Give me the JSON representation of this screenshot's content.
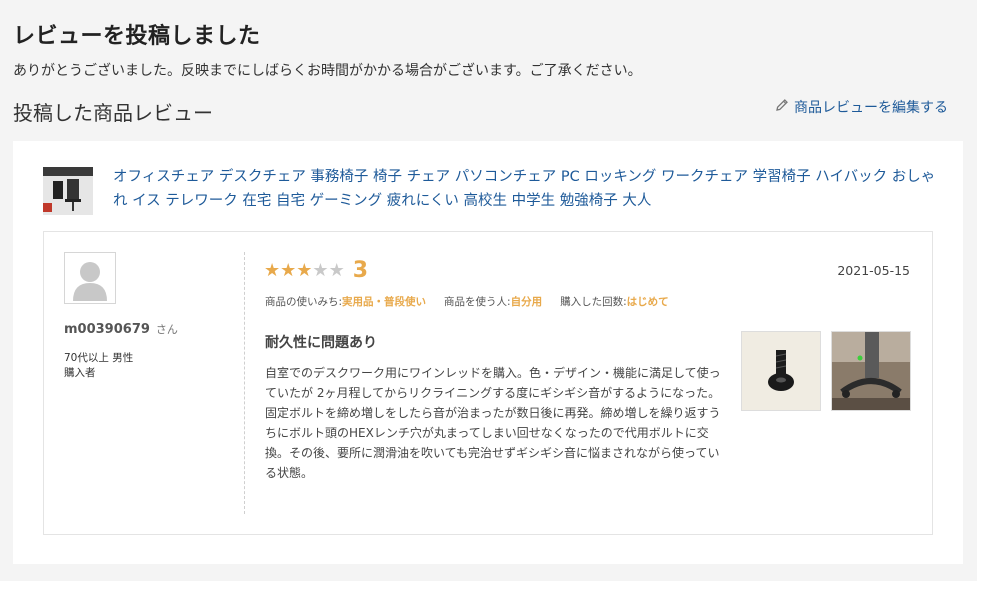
{
  "header": {
    "title": "レビューを投稿しました",
    "message": "ありがとうございました。反映までにしばらくお時間がかかる場合がございます。ご了承ください。"
  },
  "section": {
    "title": "投稿した商品レビュー",
    "edit_link": "商品レビューを編集する",
    "edit_icon": "pencil-icon"
  },
  "product": {
    "title": "オフィスチェア デスクチェア 事務椅子 椅子 チェア パソコンチェア PC ロッキング ワークチェア 学習椅子 ハイバック おしゃれ イス テレワーク 在宅 自宅 ゲーミング 疲れにくい 高校生 中学生 勉強椅子 大人"
  },
  "review": {
    "reviewer_name": "m00390679",
    "honorific": "さん",
    "age_gender": "70代以上 男性",
    "buyer_status": "購入者",
    "rating": "3",
    "rating_value": 3,
    "rating_max": 5,
    "date": "2021-05-15",
    "meta": [
      {
        "label": "商品の使いみち:",
        "value": "実用品・普段使い"
      },
      {
        "label": "商品を使う人:",
        "value": "自分用"
      },
      {
        "label": "購入した回数:",
        "value": "はじめて"
      }
    ],
    "title": "耐久性に問題あり",
    "body": "自室でのデスクワーク用にワインレッドを購入。色・デザイン・機能に満足して使っていたが 2ヶ月程してからリクライニングする度にギシギシ音がするようになった。固定ボルトを締め増しをしたら音が治まったが数日後に再発。締め増しを繰り返すうちにボルト頭のHEXレンチ穴が丸まってしまい回せなくなったので代用ボルトに交換。その後、要所に潤滑油を吹いても完治せずギシギシ音に悩まされながら使っている状態。"
  },
  "colors": {
    "link": "#1e5a99",
    "accent_star": "#e8a94b",
    "background": "#f4f4f4"
  }
}
